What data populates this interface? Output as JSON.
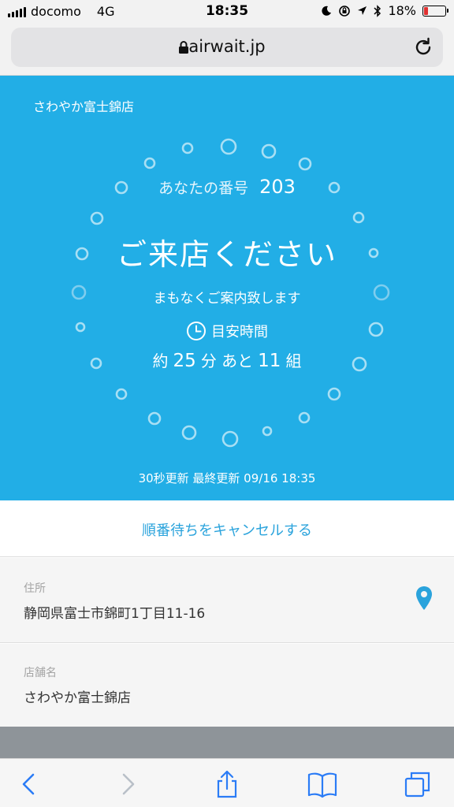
{
  "status_bar": {
    "carrier": "docomo",
    "network": "4G",
    "time": "18:35",
    "battery": "18%",
    "battery_level": 0.18
  },
  "browser": {
    "domain": "airwait.jp"
  },
  "hero": {
    "store_name": "さわやか富士錦店",
    "ticket_label": "あなたの番号",
    "ticket_number": "203",
    "headline": "ご来店ください",
    "subtext": "まもなくご案内致します",
    "estimate_label": "目安時間",
    "wait_prefix": "約",
    "wait_minutes": "25",
    "wait_minutes_unit": "分 あと",
    "wait_groups": "11",
    "wait_groups_unit": "組",
    "updated": "30秒更新 最終更新 09/16 18:35"
  },
  "cancel_label": "順番待ちをキャンセルする",
  "address": {
    "label": "住所",
    "value": "静岡県富士市錦町1丁目11-16"
  },
  "store": {
    "label": "店舗名",
    "value": "さわやか富士錦店"
  },
  "colors": {
    "hero_bg": "#22aee6",
    "link": "#2aa3dc",
    "battery_low": "#e03030"
  },
  "icons": [
    "lock-icon",
    "reload-icon",
    "clock-icon",
    "location-pin-icon",
    "back-icon",
    "forward-icon",
    "share-icon",
    "bookmarks-icon",
    "tabs-icon"
  ]
}
